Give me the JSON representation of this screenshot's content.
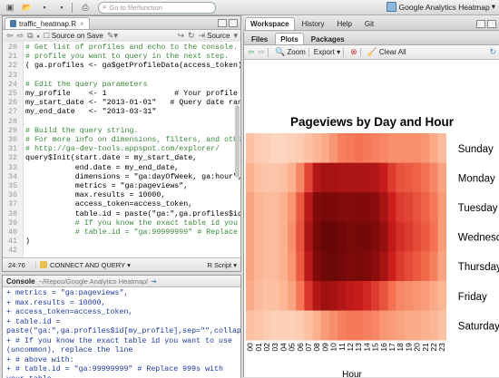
{
  "toolbar": {
    "goto_placeholder": "Go to file/function",
    "project": "Google Analytics Heatmap"
  },
  "source": {
    "tab_label": "traffic_heatmap.R",
    "source_on_save": "Source on Save",
    "source_label": "Source",
    "lines": [
      {
        "n": "20",
        "t": "# Get list of profiles and echo to the console. You will",
        "c": "comment"
      },
      {
        "n": "21",
        "t": "# profile you want to query in the next step.",
        "c": "comment"
      },
      {
        "n": "22",
        "t": "( ga.profiles <- ga$getProfileData(access_token) )",
        "c": "code"
      },
      {
        "n": "23",
        "t": "",
        "c": "code"
      },
      {
        "n": "24",
        "t": "# Edit the query parameters",
        "c": "comment"
      },
      {
        "n": "25",
        "t": "my_profile    <- 1               # Your profile number (",
        "c": "code"
      },
      {
        "n": "26",
        "t": "my_start_date <- \"2013-01-01\"   # Query date range",
        "c": "code"
      },
      {
        "n": "27",
        "t": "my_end_date   <- \"2013-03-31\"",
        "c": "code"
      },
      {
        "n": "28",
        "t": "",
        "c": "code"
      },
      {
        "n": "29",
        "t": "# Build the query string.",
        "c": "comment"
      },
      {
        "n": "30",
        "t": "# For more info on dimensions, filters, and other query",
        "c": "comment"
      },
      {
        "n": "31",
        "t": "# http://ga-dev-tools.appspot.com/explorer/",
        "c": "comment"
      },
      {
        "n": "32",
        "t": "query$Init(start.date = my_start_date,",
        "c": "code"
      },
      {
        "n": "33",
        "t": "           end.date = my_end_date,",
        "c": "code"
      },
      {
        "n": "34",
        "t": "           dimensions = \"ga:dayOfWeek, ga:hour\",",
        "c": "code"
      },
      {
        "n": "35",
        "t": "           metrics = \"ga:pageviews\",",
        "c": "code"
      },
      {
        "n": "36",
        "t": "           max.results = 10000,",
        "c": "code"
      },
      {
        "n": "37",
        "t": "           access_token=access_token,",
        "c": "code"
      },
      {
        "n": "38",
        "t": "           table.id = paste(\"ga:\",ga.profiles$id[my_pro",
        "c": "code"
      },
      {
        "n": "39",
        "t": "           # If you know the exact table id you want to",
        "c": "comment"
      },
      {
        "n": "40",
        "t": "           # table.id = \"ga:99999999\" # Replace 999s wi",
        "c": "comment"
      },
      {
        "n": "41",
        "t": ")",
        "c": "code"
      },
      {
        "n": "42",
        "t": "",
        "c": "code"
      }
    ],
    "status_pos": "24:76",
    "status_fn": "CONNECT AND QUERY",
    "status_lang": "R Script"
  },
  "console": {
    "title": "Console",
    "path": "~/Repos/Google Analytics Heatmap/",
    "text": "+ metrics = \"ga:pageviews\",\n+ max.results = 10000,\n+ access_token=access_token,\n+ table.id =\npaste(\"ga:\",ga.profiles$id[my_profile],sep=\"\",collapse=\",\")\n+ # If you know the exact table id you want to use\n(uncommon), replace the line\n+ # above with:\n+ # table.id = \"ga:99999999\" # Replace 999s with your table\nID."
  },
  "workspace_tabs": [
    "Workspace",
    "History",
    "Help",
    "Git"
  ],
  "plots_tabs": [
    "Files",
    "Plots",
    "Packages"
  ],
  "plots_toolbar": {
    "zoom": "Zoom",
    "export": "Export",
    "clear": "Clear All"
  },
  "chart_data": {
    "type": "heatmap",
    "title": "Pageviews by Day and Hour",
    "xlabel": "Hour",
    "ylabel": "",
    "rows": [
      "Sunday",
      "Monday",
      "Tuesday",
      "Wednesday",
      "Thursday",
      "Friday",
      "Saturday"
    ],
    "row_labels_shown": [
      "Sunday",
      "Monday",
      "Tuesday",
      "Wednesd",
      "Thursday",
      "Friday",
      "Saturday"
    ],
    "cols": [
      "00",
      "01",
      "02",
      "03",
      "04",
      "05",
      "06",
      "07",
      "08",
      "09",
      "10",
      "11",
      "12",
      "13",
      "14",
      "15",
      "16",
      "17",
      "18",
      "19",
      "20",
      "21",
      "22",
      "23"
    ],
    "colors": [
      "#fde4d4",
      "#fbb18e",
      "#f36a4a",
      "#cd1e1e",
      "#8a0c0c",
      "#5e0606"
    ],
    "values": [
      [
        0.14,
        0.1,
        0.08,
        0.06,
        0.06,
        0.08,
        0.1,
        0.14,
        0.18,
        0.22,
        0.28,
        0.34,
        0.36,
        0.38,
        0.36,
        0.34,
        0.32,
        0.3,
        0.3,
        0.3,
        0.3,
        0.28,
        0.22,
        0.16
      ],
      [
        0.2,
        0.14,
        0.12,
        0.12,
        0.14,
        0.2,
        0.32,
        0.5,
        0.68,
        0.72,
        0.72,
        0.7,
        0.7,
        0.7,
        0.7,
        0.68,
        0.62,
        0.52,
        0.46,
        0.44,
        0.42,
        0.38,
        0.32,
        0.24
      ],
      [
        0.24,
        0.18,
        0.16,
        0.16,
        0.2,
        0.28,
        0.44,
        0.66,
        0.84,
        0.88,
        0.86,
        0.84,
        0.82,
        0.84,
        0.84,
        0.8,
        0.72,
        0.6,
        0.52,
        0.5,
        0.46,
        0.42,
        0.36,
        0.26
      ],
      [
        0.24,
        0.18,
        0.16,
        0.16,
        0.2,
        0.3,
        0.46,
        0.7,
        0.88,
        0.96,
        0.96,
        0.92,
        0.88,
        0.9,
        0.9,
        0.84,
        0.76,
        0.64,
        0.56,
        0.52,
        0.48,
        0.44,
        0.38,
        0.26
      ],
      [
        0.24,
        0.18,
        0.16,
        0.16,
        0.2,
        0.28,
        0.44,
        0.66,
        0.84,
        0.92,
        0.94,
        0.9,
        0.86,
        0.88,
        0.86,
        0.8,
        0.72,
        0.6,
        0.52,
        0.48,
        0.44,
        0.4,
        0.34,
        0.24
      ],
      [
        0.22,
        0.16,
        0.14,
        0.14,
        0.18,
        0.24,
        0.36,
        0.54,
        0.68,
        0.74,
        0.72,
        0.68,
        0.64,
        0.62,
        0.58,
        0.52,
        0.46,
        0.38,
        0.32,
        0.3,
        0.28,
        0.26,
        0.22,
        0.18
      ],
      [
        0.14,
        0.12,
        0.1,
        0.08,
        0.08,
        0.08,
        0.1,
        0.14,
        0.2,
        0.26,
        0.3,
        0.34,
        0.36,
        0.36,
        0.34,
        0.32,
        0.28,
        0.26,
        0.24,
        0.22,
        0.22,
        0.2,
        0.18,
        0.14
      ]
    ]
  }
}
